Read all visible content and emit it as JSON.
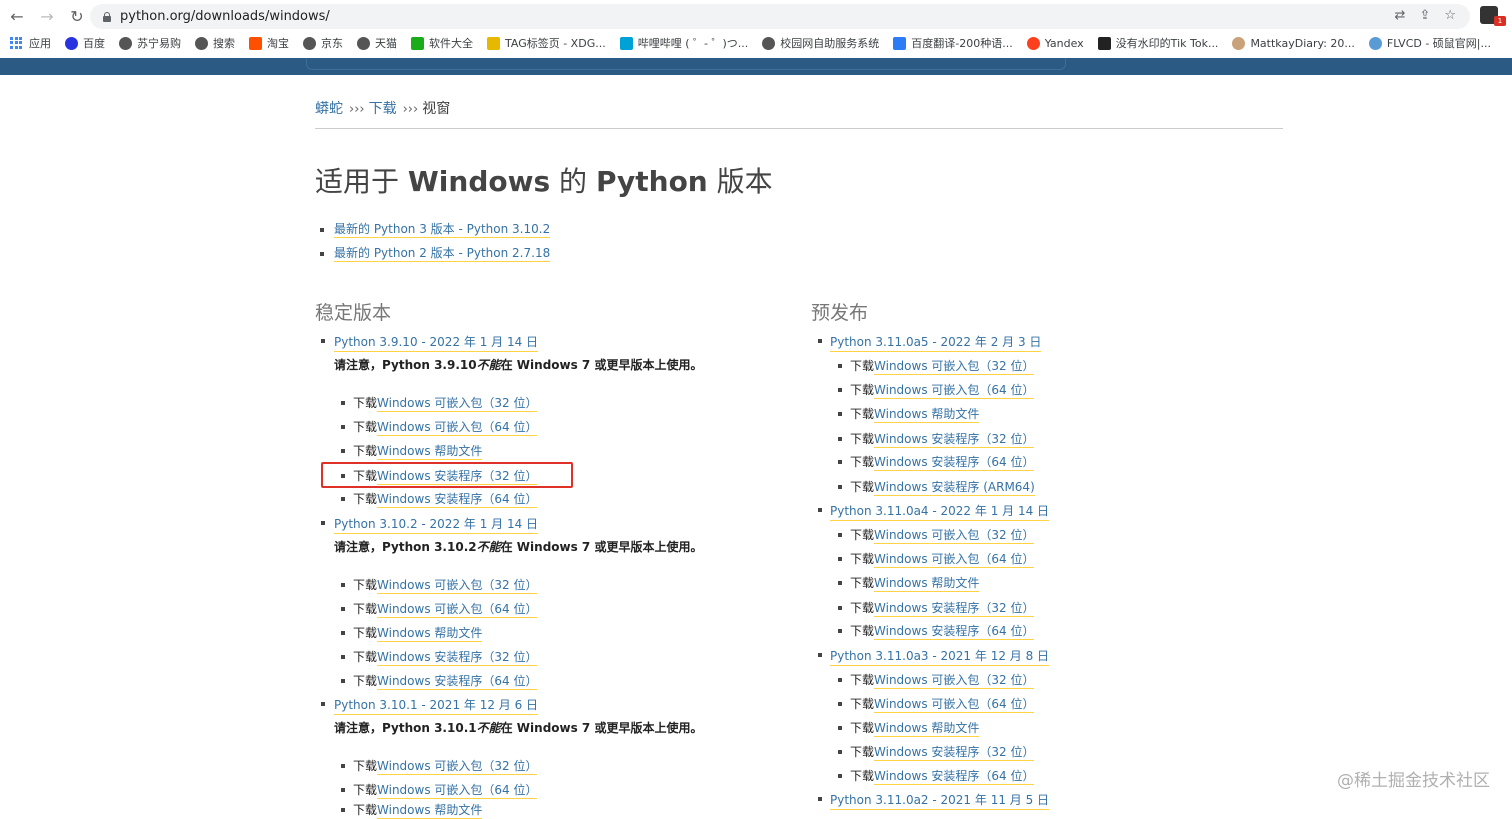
{
  "browser": {
    "url": "python.org/downloads/windows/",
    "bookmarks": [
      "应用",
      "百度",
      "苏宁易购",
      "搜索",
      "淘宝",
      "京东",
      "天猫",
      "软件大全",
      "TAG标签页 - XDG...",
      "哔哩哔哩 ( ゜- ゜)つ...",
      "校园网自助服务系统",
      "百度翻译-200种语...",
      "Yandex",
      "没有水印的Tik Tok...",
      "MattkayDiary: 20...",
      "FLVCD - 硕鼠官网|..."
    ],
    "ext_badge": "1"
  },
  "breadcrumb": {
    "root": "蟒蛇",
    "sep": "›››",
    "downloads": "下载",
    "current": "视窗"
  },
  "page": {
    "title_a": "适用于 ",
    "title_b": "Windows",
    "title_c": " 的 ",
    "title_d": "Python",
    "title_e": " 版本",
    "latest3": "最新的 Python 3 版本 - Python 3.10.2",
    "latest2": "最新的 Python 2 版本 - Python 2.7.18"
  },
  "stable": {
    "heading": "稳定版本",
    "releases": [
      {
        "title": "Python 3.9.10 - 2022 年 1 月 14 日",
        "note_a": "请注意，Python 3.9.10",
        "note_b": "不能",
        "note_c": "在 Windows 7 或更早版本上使用。"
      },
      {
        "title": "Python 3.10.2 - 2022 年 1 月 14 日",
        "note_a": "请注意，Python 3.10.2",
        "note_b": "不能",
        "note_c": "在 Windows 7 或更早版本上使用。"
      },
      {
        "title": "Python 3.10.1 - 2021 年 12 月 6 日",
        "note_a": "请注意，Python 3.10.1",
        "note_b": "不能",
        "note_c": "在 Windows 7 或更早版本上使用。"
      }
    ]
  },
  "pre": {
    "heading": "预发布",
    "releases": [
      {
        "title": "Python 3.11.0a5 - 2022 年 2 月 3 日"
      },
      {
        "title": "Python 3.11.0a4 - 2022 年 1 月 14 日"
      },
      {
        "title": "Python 3.11.0a3 - 2021 年 12 月 8 日"
      },
      {
        "title": "Python 3.11.0a2 - 2021 年 11 月 5 日"
      }
    ]
  },
  "dl": {
    "prefix": "下载",
    "emb32": "Windows 可嵌入包（32 位）",
    "emb64": "Windows 可嵌入包（64 位）",
    "help": "Windows 帮助文件",
    "inst32": "Windows 安装程序（32 位）",
    "inst64": "Windows 安装程序（64 位）",
    "instarm": "Windows 安装程序 (ARM64)",
    "help_cut": "Windows 帮助文件"
  },
  "watermark": "@稀土掘金技术社区"
}
